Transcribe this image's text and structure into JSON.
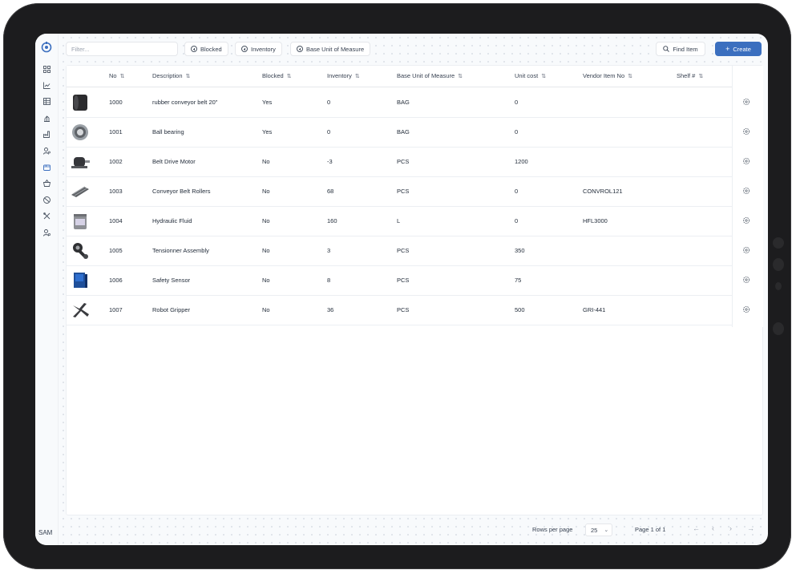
{
  "sidebar": {
    "icons": [
      "dashboard-icon",
      "chart-icon",
      "table-icon",
      "scale-icon",
      "factory-icon",
      "user-config-icon",
      "box-icon",
      "basket-icon",
      "globe-icon",
      "tools-icon",
      "user-settings-icon"
    ],
    "user_label": "SAM"
  },
  "toolbar": {
    "filter_placeholder": "Filter...",
    "chips": [
      "Blocked",
      "Inventory",
      "Base Unit of Measure"
    ],
    "find_label": "Find Item",
    "create_label": "Create"
  },
  "table": {
    "columns": [
      "No",
      "Description",
      "Blocked",
      "Inventory",
      "Base Unit of Measure",
      "Unit cost",
      "Vendor Item No",
      "Shelf #"
    ],
    "rows": [
      {
        "thumb": "conveyor-belt-icon",
        "no": "1000",
        "description": "rubber conveyor belt 20\"",
        "blocked": "Yes",
        "inventory": "0",
        "uom": "BAG",
        "unit_cost": "0",
        "vendor_no": "",
        "shelf": ""
      },
      {
        "thumb": "ball-bearing-icon",
        "no": "1001",
        "description": "Ball bearing",
        "blocked": "Yes",
        "inventory": "0",
        "uom": "BAG",
        "unit_cost": "0",
        "vendor_no": "",
        "shelf": ""
      },
      {
        "thumb": "motor-icon",
        "no": "1002",
        "description": "Belt Drive Motor",
        "blocked": "No",
        "inventory": "-3",
        "uom": "PCS",
        "unit_cost": "1200",
        "vendor_no": "",
        "shelf": ""
      },
      {
        "thumb": "rollers-icon",
        "no": "1003",
        "description": "Conveyor Belt Rollers",
        "blocked": "No",
        "inventory": "68",
        "uom": "PCS",
        "unit_cost": "0",
        "vendor_no": "CONVROL121",
        "shelf": ""
      },
      {
        "thumb": "fluid-bucket-icon",
        "no": "1004",
        "description": "Hydraulic Fluid",
        "blocked": "No",
        "inventory": "160",
        "uom": "L",
        "unit_cost": "0",
        "vendor_no": "HFL3000",
        "shelf": ""
      },
      {
        "thumb": "tensioner-icon",
        "no": "1005",
        "description": "Tensionner Assembly",
        "blocked": "No",
        "inventory": "3",
        "uom": "PCS",
        "unit_cost": "350",
        "vendor_no": "",
        "shelf": ""
      },
      {
        "thumb": "sensor-box-icon",
        "no": "1006",
        "description": "Safety Sensor",
        "blocked": "No",
        "inventory": "8",
        "uom": "PCS",
        "unit_cost": "75",
        "vendor_no": "",
        "shelf": ""
      },
      {
        "thumb": "gripper-icon",
        "no": "1007",
        "description": "Robot Gripper",
        "blocked": "No",
        "inventory": "36",
        "uom": "PCS",
        "unit_cost": "500",
        "vendor_no": "GRI-441",
        "shelf": ""
      }
    ]
  },
  "footer": {
    "rows_per_page_label": "Rows per page",
    "rows_per_page_value": "25",
    "page_label": "Page 1 of 1"
  },
  "colors": {
    "accent": "#3b6fbf",
    "device": "#1c1c1e"
  }
}
